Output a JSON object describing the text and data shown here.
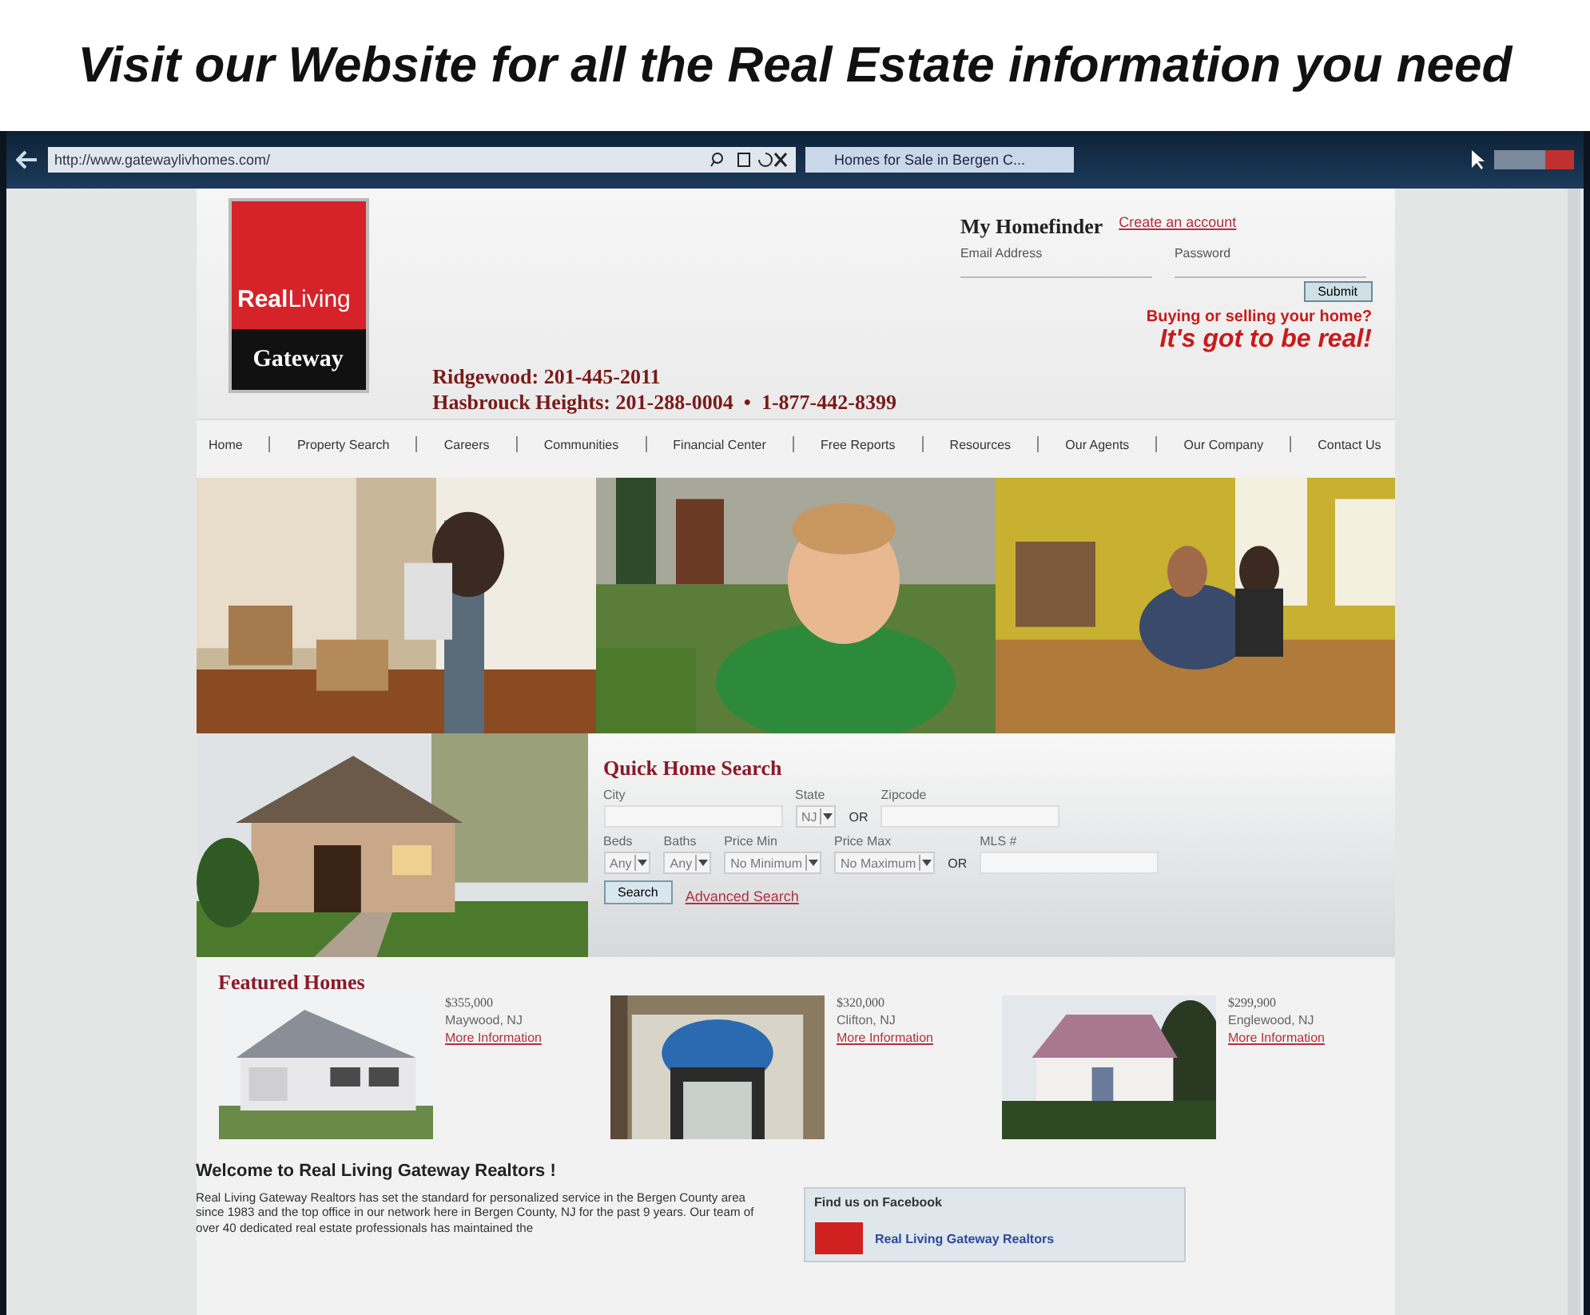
{
  "caption": "Visit our Website for all the Real Estate information you need",
  "browser": {
    "url": "http://www.gatewaylivhomes.com/",
    "tab_title": "Homes for Sale in Bergen C..."
  },
  "site": {
    "logo": {
      "top": "**Real**Living",
      "bottom": "Gateway"
    },
    "phones": [
      "Ridgewood: 201-445-2011",
      "Hasbrouck Heights: 201-288-0004  •  1-877-442-8399"
    ],
    "homefinder": {
      "title": "My Homefinder",
      "create_link": "Create an account",
      "email_label": "Email Address",
      "password_label": "Password",
      "submit": "Submit"
    },
    "tagline": [
      "Buying or selling your home?",
      "It's got to be real!"
    ],
    "nav": [
      "Home",
      "Property Search",
      "Careers",
      "Communities",
      "Financial Center",
      "Free Reports",
      "Resources",
      "Our Agents",
      "Our Company",
      "Contact Us"
    ],
    "hero": [
      {
        "kind": "picture"
      },
      {
        "kind": "picture"
      },
      {
        "kind": "picture"
      }
    ],
    "search": {
      "title": "Quick Home Search",
      "location": {
        "fields": [
          {
            "kind": "text",
            "label": "City"
          },
          {
            "kind": "select",
            "label": "State",
            "value": "NJ"
          },
          {
            "kind": "or",
            "value": "OR"
          },
          {
            "kind": "text",
            "label": "Zipcode"
          }
        ]
      },
      "details": {
        "fields": [
          {
            "kind": "select",
            "label": "Beds",
            "value": "Any"
          },
          {
            "kind": "select",
            "label": "Baths",
            "value": "Any"
          },
          {
            "kind": "select",
            "label": "Price Min",
            "value": "No Minimum"
          },
          {
            "kind": "select",
            "label": "Price Max",
            "value": "No Maximum"
          },
          {
            "kind": "or",
            "value": "OR"
          },
          {
            "kind": "text",
            "label": "MLS #"
          }
        ]
      },
      "button": "Search",
      "advanced_link": "Advanced Search"
    },
    "featured": {
      "title": "Featured Homes",
      "homes": [
        {
          "price": "$355,000",
          "town": "Maywood, NJ",
          "link": "More Information"
        },
        {
          "price": "$320,000",
          "town": "Clifton, NJ",
          "link": "More Information"
        },
        {
          "price": "$299,900",
          "town": "Englewood, NJ",
          "link": "More Information"
        }
      ]
    },
    "welcome": {
      "title": "Welcome to Real Living Gateway Realtors !",
      "text": "Real Living Gateway Realtors has set the standard for personalized service in the Bergen County area since 1983 and the top office in our network here in Bergen County, NJ for the past 9 years.  Our team of over 40 dedicated real estate professionals has maintained the"
    },
    "facebook": {
      "title": "Find us on Facebook",
      "page_name": "Real Living Gateway Realtors"
    }
  }
}
